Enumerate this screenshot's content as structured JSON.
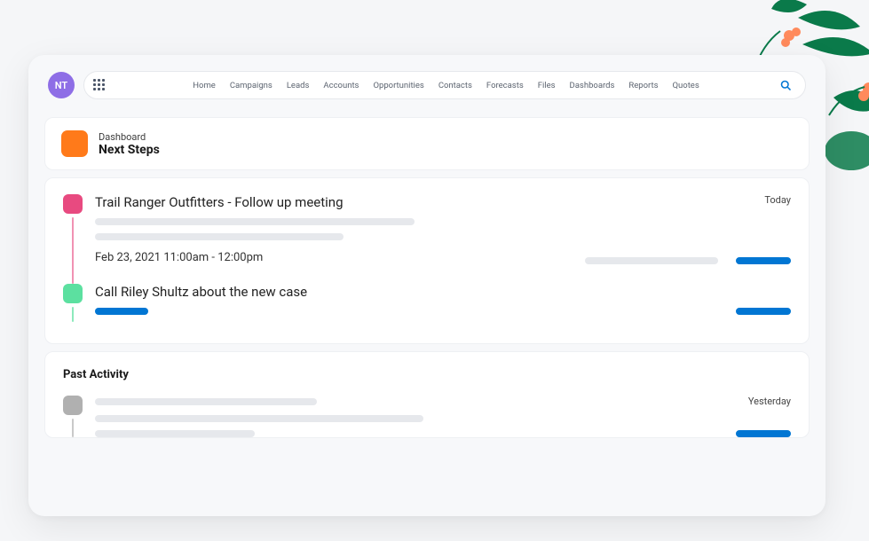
{
  "avatar": {
    "initials": "NT"
  },
  "nav": {
    "items": [
      "Home",
      "Campaigns",
      "Leads",
      "Accounts",
      "Opportunities",
      "Contacts",
      "Forecasts",
      "Files",
      "Dashboards",
      "Reports",
      "Quotes"
    ]
  },
  "header": {
    "kicker": "Dashboard",
    "title": "Next Steps"
  },
  "timeline": {
    "items": [
      {
        "color": "pink",
        "title": "Trail Ranger Outfitters - Follow up meeting",
        "dateLabel": "Today",
        "time": "Feb 23, 2021 11:00am - 12:00pm"
      },
      {
        "color": "green",
        "title": "Call Riley Shultz about the new case",
        "dateLabel": "",
        "time": ""
      }
    ]
  },
  "past": {
    "heading": "Past Activity",
    "dateLabel": "Yesterday"
  },
  "colors": {
    "accent": "#0176d3",
    "orange": "#ff7a1a",
    "pink": "#e84a80",
    "green": "#5ce0a0",
    "purple": "#8e6ee6"
  }
}
